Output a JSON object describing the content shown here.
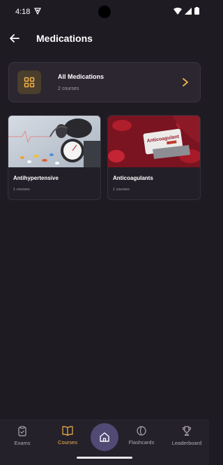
{
  "status": {
    "time": "4:18"
  },
  "header": {
    "title": "Medications"
  },
  "all_card": {
    "title": "All Medications",
    "subtitle": "2 courses"
  },
  "courses": [
    {
      "name": "Antihypertensive",
      "count": "1 courses"
    },
    {
      "name": "Anticoagulants",
      "count": "1 courses",
      "thumb_text": "Anticoagulant"
    }
  ],
  "nav": {
    "items": [
      {
        "label": "Exams",
        "icon": "clipboard-icon"
      },
      {
        "label": "Courses",
        "icon": "book-icon",
        "active": true
      },
      {
        "label": "",
        "icon": "home-icon"
      },
      {
        "label": "Flashcards",
        "icon": "card-icon"
      },
      {
        "label": "Leaderboard",
        "icon": "trophy-icon"
      }
    ]
  },
  "colors": {
    "accent": "#f2b24a",
    "background": "#1e1b23",
    "home": "#514a74"
  }
}
